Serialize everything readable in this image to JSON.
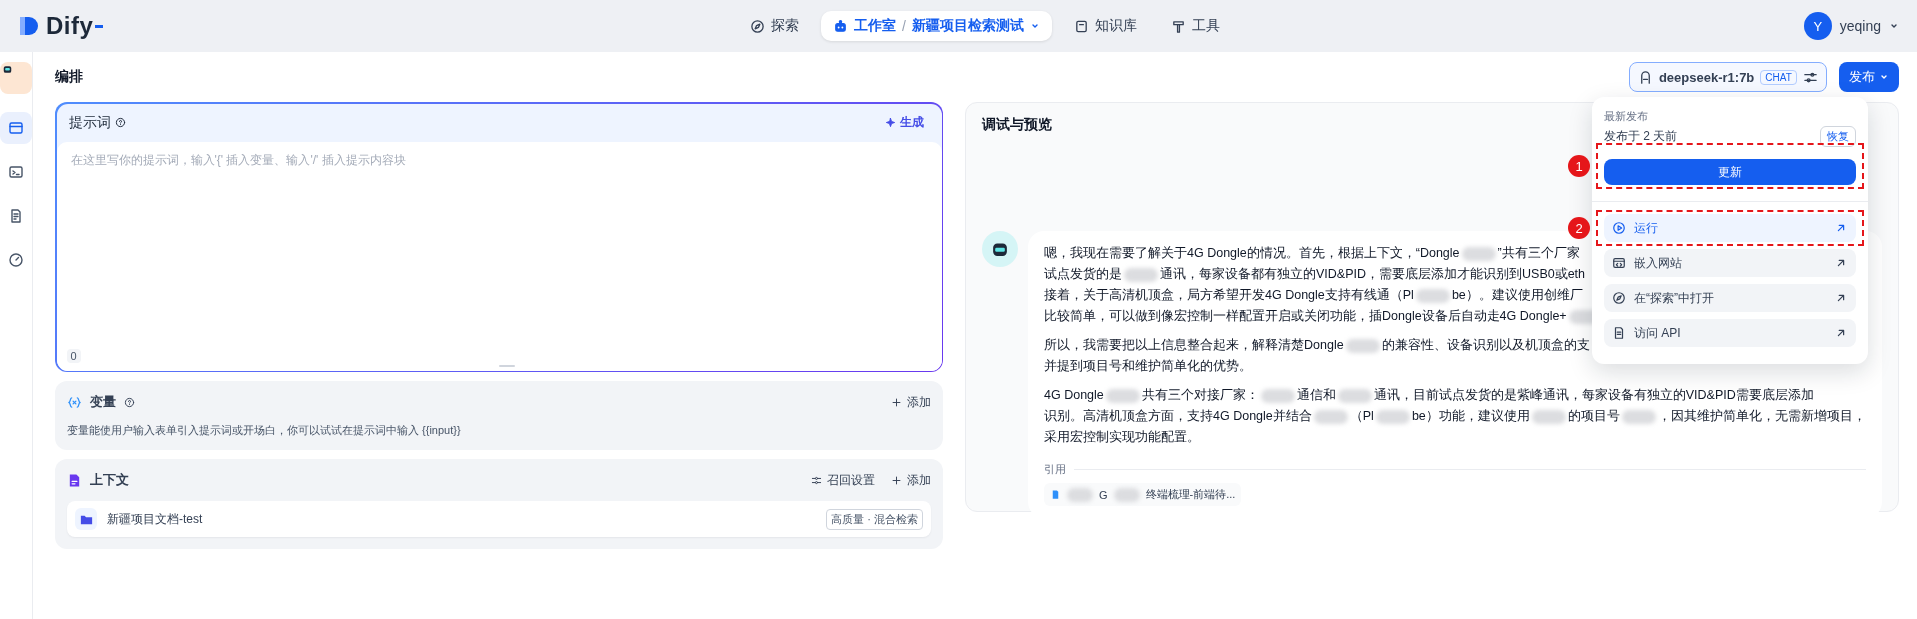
{
  "app": {
    "logo": "Dify"
  },
  "nav": [
    {
      "kind": "link",
      "label": "探索",
      "selected": false
    },
    {
      "kind": "breadcrumb",
      "label": "工作室",
      "separator": "/",
      "sublabel": "新疆项目检索测试",
      "selected": true
    },
    {
      "kind": "link",
      "label": "知识库",
      "selected": false
    },
    {
      "kind": "link",
      "label": "工具",
      "selected": false
    }
  ],
  "user": {
    "avatar": "Y",
    "name": "yeqing"
  },
  "sidebar": {
    "items": [
      {
        "selected": true
      },
      {
        "selected": false
      },
      {
        "selected": false
      },
      {
        "selected": false
      }
    ]
  },
  "editor": {
    "title": "编排",
    "prompt": {
      "label": "提示词",
      "generate": "生成",
      "placeholder": "在这里写你的提示词，输入'{' 插入变量、输入'/' 插入提示内容块",
      "count": "0"
    },
    "variables": {
      "label": "变量",
      "add": "添加",
      "description": "变量能使用户输入表单引入提示词或开场白，你可以试试在提示词中输入 {{input}}"
    },
    "context": {
      "label": "上下文",
      "retrieval": "召回设置",
      "add": "添加",
      "datasets": [
        {
          "name": "新疆项目文档-test",
          "tag": "高质量 · 混合检索"
        }
      ]
    }
  },
  "model": {
    "name": "deepseek-r1:7b",
    "badge": "CHAT"
  },
  "publish_button": "发布",
  "debug": {
    "title": "调试与预览",
    "message": {
      "paragraphs": [
        [
          [
            {
              "kind": "text",
              "text": "嗯，我现在需要了解关于4G Dongle的情况。首先，根据上下文，“Dongle"
            },
            {
              "kind": "redacted"
            },
            {
              "kind": "text",
              "text": "”共有三个厂家"
            }
          ],
          [
            {
              "kind": "text",
              "text": "试点发货的是"
            },
            {
              "kind": "redacted"
            },
            {
              "kind": "text",
              "text": "通讯，每家设备都有独立的VID&PID，需要底层添加才能识别到USB0或eth"
            }
          ],
          [
            {
              "kind": "text",
              "text": "接着，关于高清机顶盒，局方希望开发4G Dongle支持有线通（Pl"
            },
            {
              "kind": "redacted"
            },
            {
              "kind": "text",
              "text": "be）。建议使用创维厂"
            }
          ],
          [
            {
              "kind": "text",
              "text": "比较简单，可以做到像宏控制一样配置开启或关闭功能，插Dongle设备后自动走4G Dongle+"
            },
            {
              "kind": "redacted"
            }
          ]
        ],
        [
          [
            {
              "kind": "text",
              "text": "所以，我需要把以上信息整合起来，解释清楚Dongle"
            },
            {
              "kind": "redacted"
            },
            {
              "kind": "text",
              "text": "的兼容性、设备识别以及机顶盒的支"
            }
          ],
          [
            {
              "kind": "text",
              "text": "并提到项目号和维护简单化的优势。"
            }
          ]
        ],
        [
          [
            {
              "kind": "text",
              "text": "4G Dongle"
            },
            {
              "kind": "redacted"
            },
            {
              "kind": "text",
              "text": "共有三个对接厂家："
            },
            {
              "kind": "redacted"
            },
            {
              "kind": "text",
              "text": "通信和"
            },
            {
              "kind": "redacted"
            },
            {
              "kind": "text",
              "text": "通讯，目前试点发货的是紫峰通讯，每家设备有独立的VID&PID需要底层添加"
            }
          ],
          [
            {
              "kind": "text",
              "text": "识别。高清机顶盒方面，支持4G Dongle并结合"
            },
            {
              "kind": "redacted"
            },
            {
              "kind": "text",
              "text": "（Pl"
            },
            {
              "kind": "redacted"
            },
            {
              "kind": "text",
              "text": "be）功能，建议使用"
            },
            {
              "kind": "redacted"
            },
            {
              "kind": "text",
              "text": "的项目号"
            },
            {
              "kind": "redacted"
            },
            {
              "kind": "text",
              "text": "，因其维护简单化，无需新增项目，"
            }
          ],
          [
            {
              "kind": "text",
              "text": "采用宏控制实现功能配置。"
            }
          ]
        ]
      ],
      "citation_label": "引用",
      "citations": [
        [
          {
            "kind": "redacted"
          },
          {
            "kind": "text",
            "text": "G"
          },
          {
            "kind": "redacted"
          },
          {
            "kind": "text",
            "text": "终端梳理-前端待..."
          }
        ]
      ]
    }
  },
  "publish_menu": {
    "heading": "最新发布",
    "published": "发布于 2 天前",
    "restore": "恢复",
    "update": "更新",
    "items": [
      {
        "label": "运行",
        "selected": true
      },
      {
        "label": "嵌入网站",
        "selected": false
      },
      {
        "label": "在“探索”中打开",
        "selected": false
      },
      {
        "label": "访问 API",
        "selected": false
      }
    ]
  },
  "annotations": [
    {
      "number": "1"
    },
    {
      "number": "2"
    }
  ]
}
